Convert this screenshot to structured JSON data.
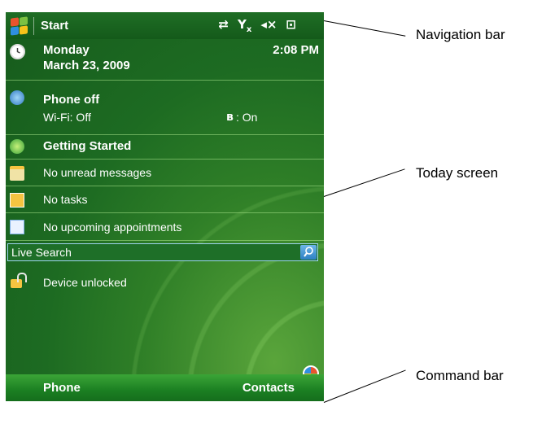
{
  "navbar": {
    "start_label": "Start",
    "status_icons": [
      "sync-icon",
      "antenna-off-icon",
      "speaker-muted-icon",
      "battery-charging-icon"
    ]
  },
  "today": {
    "day": "Monday",
    "date": "March 23, 2009",
    "time": "2:08 PM",
    "phone_status": "Phone off",
    "wifi_status": "Wi-Fi: Off",
    "bluetooth_status": ": On",
    "getting_started": "Getting Started",
    "messages": "No unread messages",
    "tasks": "No tasks",
    "appointments": "No upcoming appointments",
    "search_label": "Live Search",
    "device_lock": "Device unlocked"
  },
  "command_bar": {
    "left": "Phone",
    "right": "Contacts"
  },
  "callouts": {
    "navigation_bar": "Navigation bar",
    "today_screen": "Today screen",
    "command_bar": "Command bar"
  },
  "colors": {
    "screen_green": "#1d6b22",
    "search_blue": "#2d7fc2"
  }
}
